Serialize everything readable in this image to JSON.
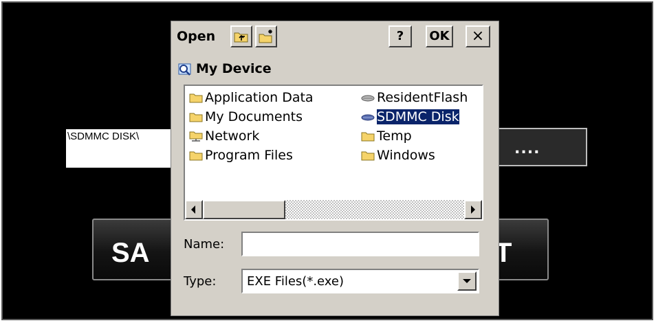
{
  "background": {
    "path_value": "\\SDMMC DISK\\",
    "browse_label": "....",
    "left_button_label": "SA",
    "right_button_label": "T"
  },
  "dialog": {
    "title": "Open",
    "help_label": "?",
    "ok_label": "OK",
    "close_label": "×",
    "location": "My Device",
    "items": [
      {
        "label": "Application Data",
        "icon": "folder-icon"
      },
      {
        "label": "My Documents",
        "icon": "folder-icon"
      },
      {
        "label": "Network",
        "icon": "network-folder-icon"
      },
      {
        "label": "Program Files",
        "icon": "folder-icon"
      },
      {
        "label": "ResidentFlash",
        "icon": "drive-icon"
      },
      {
        "label": "SDMMC Disk",
        "icon": "storage-card-icon",
        "selected": true
      },
      {
        "label": "Temp",
        "icon": "folder-icon"
      },
      {
        "label": "Windows",
        "icon": "folder-icon"
      }
    ],
    "name_label": "Name:",
    "name_value": "",
    "type_label": "Type:",
    "type_value": "EXE Files(*.exe)"
  },
  "colors": {
    "dialog_bg": "#d4d0c8",
    "selection": "#0a246a",
    "folder": "#f5d36a"
  }
}
